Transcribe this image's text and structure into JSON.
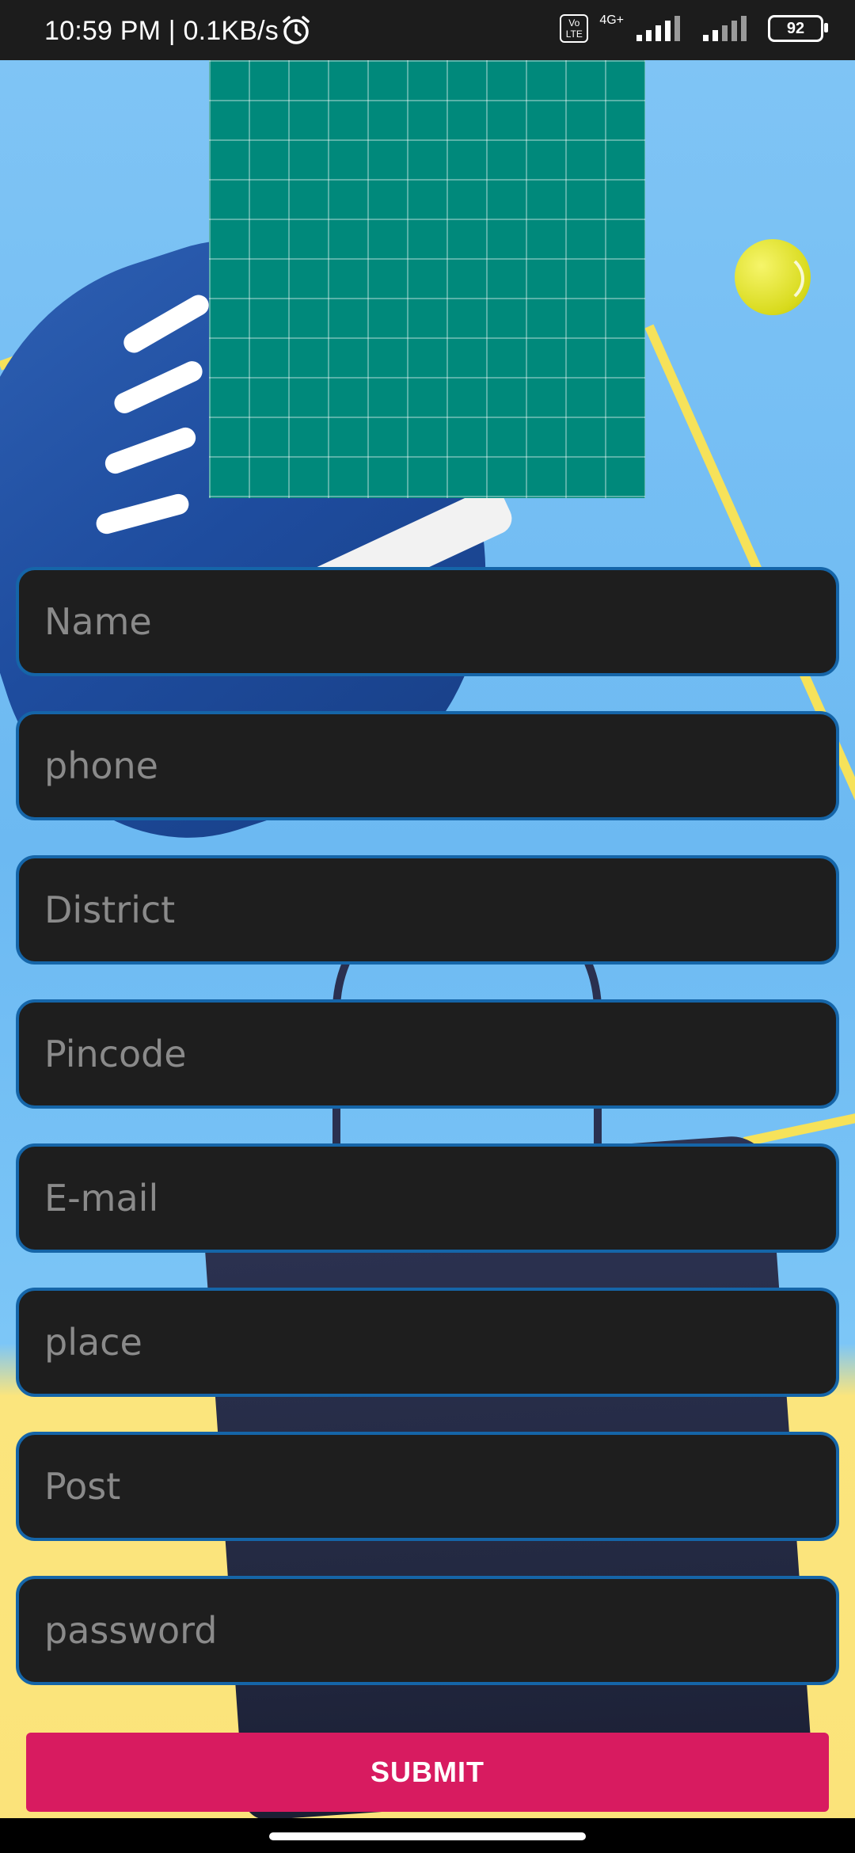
{
  "status_bar": {
    "time": "10:59 PM | 0.1KB/s",
    "volte_label": "Vo LTE",
    "network_label": "4G+",
    "battery": "92",
    "icons": [
      "alarm-icon",
      "volte-icon",
      "signal-icon",
      "signal-icon-2",
      "battery-icon"
    ]
  },
  "form": {
    "fields": [
      {
        "placeholder": "Name"
      },
      {
        "placeholder": "phone"
      },
      {
        "placeholder": "District"
      },
      {
        "placeholder": "Pincode"
      },
      {
        "placeholder": "E-mail"
      },
      {
        "placeholder": "place"
      },
      {
        "placeholder": "Post"
      },
      {
        "placeholder": "password"
      }
    ],
    "submit_label": "SUBMIT"
  },
  "colors": {
    "field_bg": "#1e1e1e",
    "field_border": "#1565a8",
    "submit_bg": "#d81b60",
    "grid_image": "#00897b",
    "background_sky": "#7fc4f5",
    "background_yellow": "#fbe57d"
  }
}
